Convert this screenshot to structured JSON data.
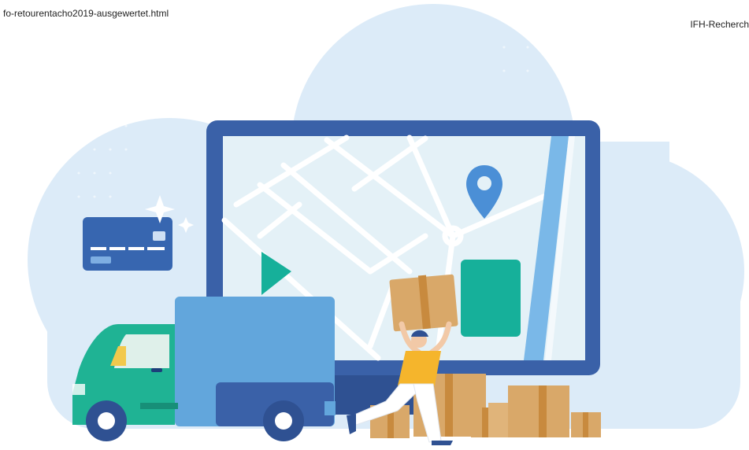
{
  "captions": {
    "left": "fo-retourentacho2019-ausgewertet.html",
    "right": "IFH-Recherch"
  },
  "illustration": {
    "icons": [
      "cloud-background-icon",
      "monitor-icon",
      "map-icon",
      "location-pin-icon",
      "credit-card-icon",
      "sparkle-icon",
      "delivery-truck-icon",
      "delivery-person-icon",
      "cardboard-box-icon"
    ]
  },
  "colors": {
    "cloud": "#dcebf8",
    "monitor_frame": "#3a61a8",
    "map_bg": "#e4f1f7",
    "map_roads": "#ffffff",
    "river": "#7ab8e8",
    "green": "#16b09a",
    "pin": "#4b8fd6",
    "truck_cargo": "#62a6dc",
    "truck_cab": "#1fb394",
    "box": "#d9a869",
    "box_tape": "#c88a3e",
    "shirt": "#f5b52c",
    "card": "#3766b0"
  }
}
